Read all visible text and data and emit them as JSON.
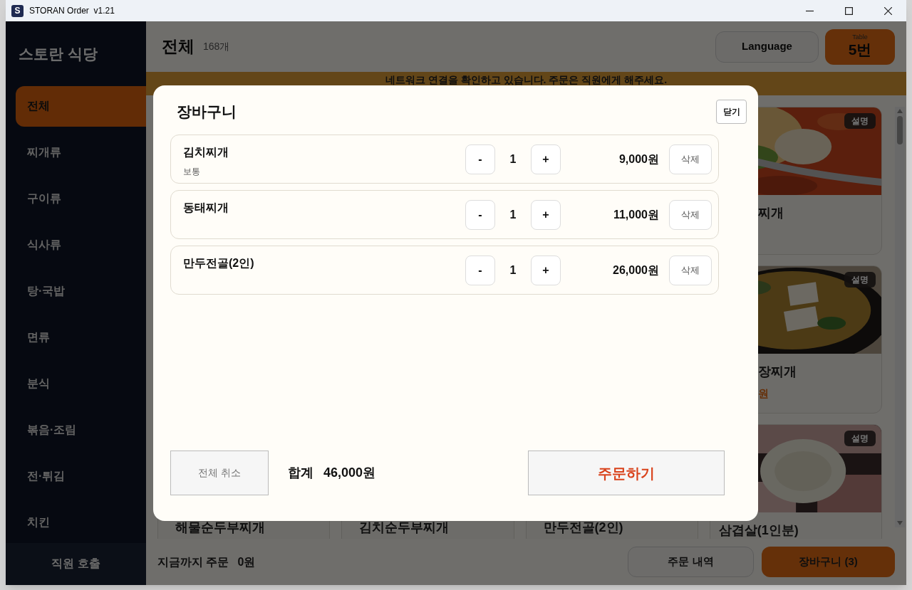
{
  "window": {
    "icon_letter": "S",
    "title": "STORAN Order  v1.21"
  },
  "sidebar": {
    "title": "스토란 식당",
    "items": [
      {
        "label": "전체",
        "selected": true
      },
      {
        "label": "찌개류",
        "selected": false
      },
      {
        "label": "구이류",
        "selected": false
      },
      {
        "label": "식사류",
        "selected": false
      },
      {
        "label": "탕·국밥",
        "selected": false
      },
      {
        "label": "면류",
        "selected": false
      },
      {
        "label": "분식",
        "selected": false
      },
      {
        "label": "볶음·조림",
        "selected": false
      },
      {
        "label": "전·튀김",
        "selected": false
      },
      {
        "label": "치킨",
        "selected": false
      }
    ],
    "footer_button": "직원 호출"
  },
  "header": {
    "category": "전체",
    "count": "168개",
    "language_button": "Language",
    "table": {
      "label": "Table",
      "number": "5번"
    }
  },
  "banner": "네트워크 연결을 확인하고 있습니다. 주문은 직원에게 해주세요.",
  "right_column_cards": [
    {
      "badge": "설명",
      "name": "찌개",
      "cut_by_dialog": true
    },
    {
      "badge": "설명",
      "name": "장찌개",
      "price": "원",
      "cut_by_dialog": true
    },
    {
      "badge": "설명",
      "name": "삼겹살(1인분)",
      "cut_by_dialog": false
    }
  ],
  "bottom_row_cards": [
    {
      "name": "해물순두부찌개"
    },
    {
      "name": "김치순두부찌개"
    },
    {
      "name": "만두전골(2인)"
    }
  ],
  "bottom_bar": {
    "total_label": "지금까지 주문",
    "total": "0원",
    "history_button": "주문 내역",
    "cart_button": "장바구니 (3)"
  },
  "cart_dialog": {
    "title": "장바구니",
    "close_button": "닫기",
    "items": [
      {
        "name": "김치찌개",
        "option": "보통",
        "minus": "-",
        "quantity": "1",
        "plus": "+",
        "price": "9,000원",
        "delete": "삭제"
      },
      {
        "name": "동태찌개",
        "minus": "-",
        "quantity": "1",
        "plus": "+",
        "price": "11,000원",
        "delete": "삭제"
      },
      {
        "name": "만두전골(2인)",
        "minus": "-",
        "quantity": "1",
        "plus": "+",
        "price": "26,000원",
        "delete": "삭제"
      }
    ],
    "cancel_all_button": "전체 취소",
    "sum_label": "합계",
    "sum": "46,000원",
    "order_button": "주문하기"
  }
}
